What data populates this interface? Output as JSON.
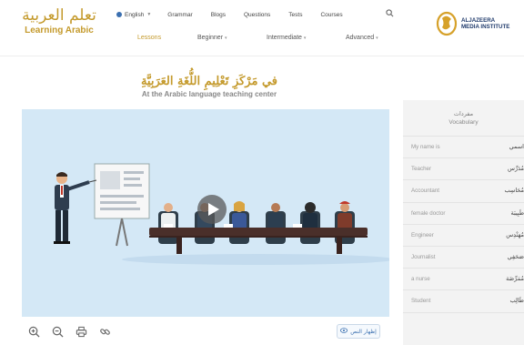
{
  "site": {
    "logo_ar": "تعلم العربية",
    "logo_en": "Learning Arabic"
  },
  "topnav": {
    "language": "English",
    "items": [
      "Grammar",
      "Blogs",
      "Questions",
      "Tests",
      "Courses"
    ],
    "search_icon": "search-icon"
  },
  "subnav": {
    "tabs": [
      {
        "label": "Lessons",
        "active": true
      },
      {
        "label": "Beginner",
        "has_dropdown": true
      },
      {
        "label": "Intermediate",
        "has_dropdown": true
      },
      {
        "label": "Advanced",
        "has_dropdown": true
      }
    ]
  },
  "partner": {
    "line1": "ALJAZEERA",
    "line2": "MEDIA INSTITUTE"
  },
  "lesson": {
    "title_ar": "في مَرْكَزِ تَعْلِيمِ اللُّغَةِ العَرَبِيَّةِ",
    "title_en": "At the Arabic language teaching center"
  },
  "video": {
    "play_icon": "play-icon",
    "colors": {
      "background": "#d4e8f6",
      "table": "#4a2f2a",
      "chair": "#2f3e4a",
      "board": "#f7f7f7"
    }
  },
  "toolbar": {
    "icons": [
      "zoom-in-icon",
      "zoom-out-icon",
      "print-icon",
      "link-icon"
    ],
    "show_text_label": "إظهار النص"
  },
  "vocabulary": {
    "title_ar": "مفردات",
    "title_en": "Vocabulary",
    "rows": [
      {
        "en": "My name is",
        "ar": "اسمي"
      },
      {
        "en": "Teacher",
        "ar": "مُدَرِّس"
      },
      {
        "en": "Accountant",
        "ar": "مُحَاسِب"
      },
      {
        "en": "female doctor",
        "ar": "طَبِيبَة"
      },
      {
        "en": "Engineer",
        "ar": "مُهَنْدِس"
      },
      {
        "en": "Journalist",
        "ar": "صَحَفِي"
      },
      {
        "en": "a nurse",
        "ar": "مُمَرِّضَة"
      },
      {
        "en": "Student",
        "ar": "طَالِب"
      }
    ]
  },
  "colors": {
    "accent_gold": "#c49a2c",
    "link_blue": "#3a6fb0",
    "panel_gray": "#f3f3f3"
  }
}
